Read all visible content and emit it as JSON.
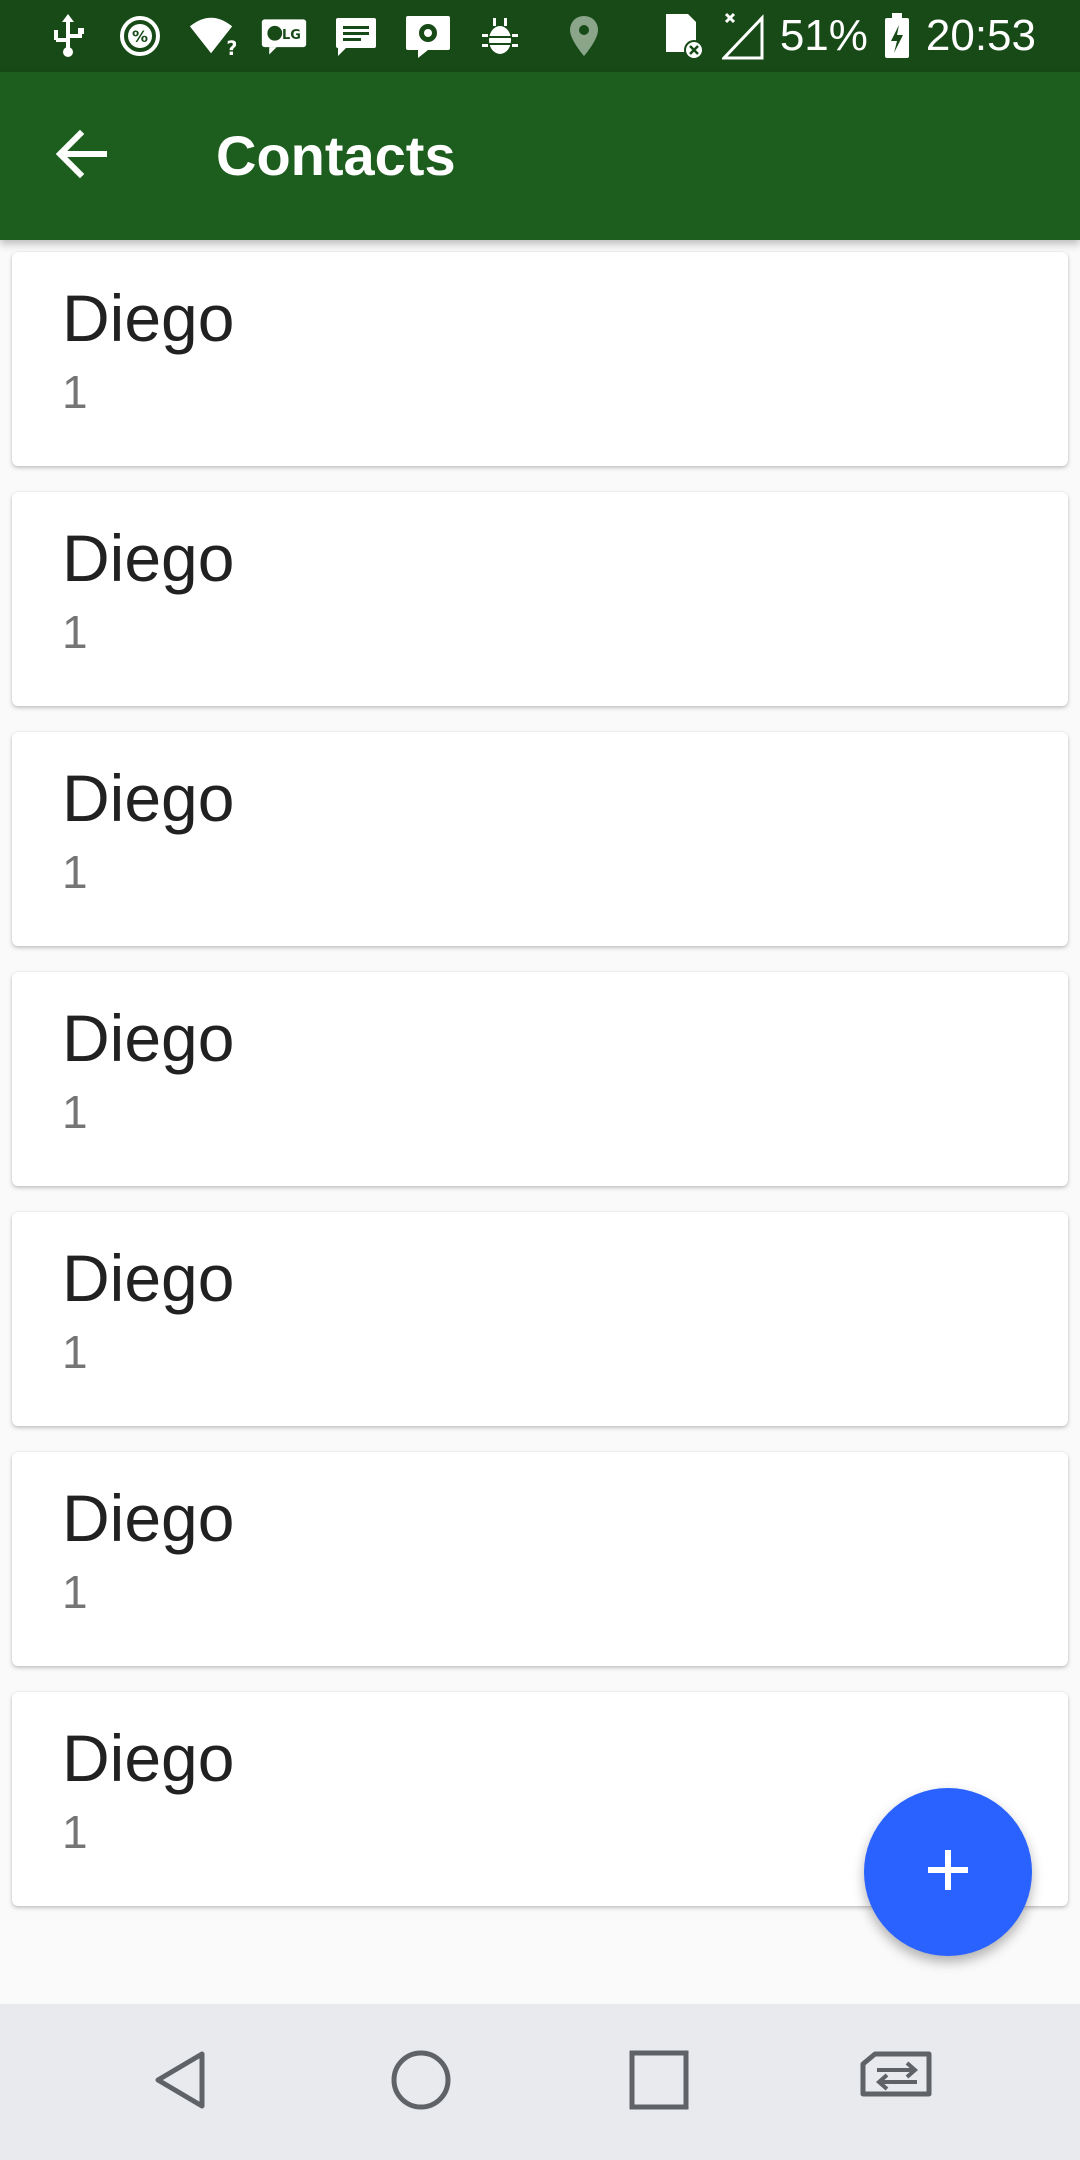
{
  "status_bar": {
    "battery_percent": "51%",
    "time": "20:53",
    "left_icons": [
      "usb-icon",
      "data-saver-icon",
      "wifi-unknown-icon",
      "lg-message-icon",
      "chat-icon",
      "settings-notification-icon",
      "bug-icon"
    ],
    "right_icons": [
      "location-icon",
      "no-sim-icon",
      "signal-icon",
      "battery-charging-icon"
    ]
  },
  "toolbar": {
    "title": "Contacts",
    "back_icon": "arrow-back-icon",
    "background_color": "#1d5e1f"
  },
  "contacts": [
    {
      "name": "Diego",
      "number": "1"
    },
    {
      "name": "Diego",
      "number": "1"
    },
    {
      "name": "Diego",
      "number": "1"
    },
    {
      "name": "Diego",
      "number": "1"
    },
    {
      "name": "Diego",
      "number": "1"
    },
    {
      "name": "Diego",
      "number": "1"
    },
    {
      "name": "Diego",
      "number": "1"
    }
  ],
  "fab": {
    "icon": "plus-icon",
    "color": "#2962ff"
  },
  "nav_bar": {
    "buttons": [
      "back-triangle-icon",
      "home-circle-icon",
      "recents-square-icon",
      "switch-sim-icon"
    ]
  }
}
